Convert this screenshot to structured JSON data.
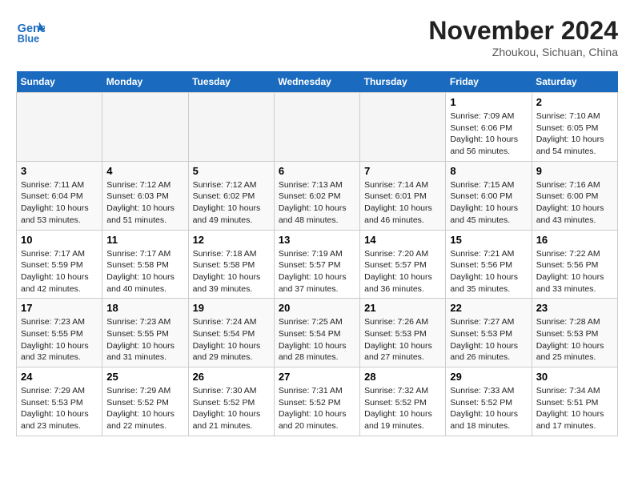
{
  "header": {
    "logo_line1": "General",
    "logo_line2": "Blue",
    "month": "November 2024",
    "location": "Zhoukou, Sichuan, China"
  },
  "weekdays": [
    "Sunday",
    "Monday",
    "Tuesday",
    "Wednesday",
    "Thursday",
    "Friday",
    "Saturday"
  ],
  "weeks": [
    [
      {
        "day": "",
        "info": ""
      },
      {
        "day": "",
        "info": ""
      },
      {
        "day": "",
        "info": ""
      },
      {
        "day": "",
        "info": ""
      },
      {
        "day": "",
        "info": ""
      },
      {
        "day": "1",
        "info": "Sunrise: 7:09 AM\nSunset: 6:06 PM\nDaylight: 10 hours\nand 56 minutes."
      },
      {
        "day": "2",
        "info": "Sunrise: 7:10 AM\nSunset: 6:05 PM\nDaylight: 10 hours\nand 54 minutes."
      }
    ],
    [
      {
        "day": "3",
        "info": "Sunrise: 7:11 AM\nSunset: 6:04 PM\nDaylight: 10 hours\nand 53 minutes."
      },
      {
        "day": "4",
        "info": "Sunrise: 7:12 AM\nSunset: 6:03 PM\nDaylight: 10 hours\nand 51 minutes."
      },
      {
        "day": "5",
        "info": "Sunrise: 7:12 AM\nSunset: 6:02 PM\nDaylight: 10 hours\nand 49 minutes."
      },
      {
        "day": "6",
        "info": "Sunrise: 7:13 AM\nSunset: 6:02 PM\nDaylight: 10 hours\nand 48 minutes."
      },
      {
        "day": "7",
        "info": "Sunrise: 7:14 AM\nSunset: 6:01 PM\nDaylight: 10 hours\nand 46 minutes."
      },
      {
        "day": "8",
        "info": "Sunrise: 7:15 AM\nSunset: 6:00 PM\nDaylight: 10 hours\nand 45 minutes."
      },
      {
        "day": "9",
        "info": "Sunrise: 7:16 AM\nSunset: 6:00 PM\nDaylight: 10 hours\nand 43 minutes."
      }
    ],
    [
      {
        "day": "10",
        "info": "Sunrise: 7:17 AM\nSunset: 5:59 PM\nDaylight: 10 hours\nand 42 minutes."
      },
      {
        "day": "11",
        "info": "Sunrise: 7:17 AM\nSunset: 5:58 PM\nDaylight: 10 hours\nand 40 minutes."
      },
      {
        "day": "12",
        "info": "Sunrise: 7:18 AM\nSunset: 5:58 PM\nDaylight: 10 hours\nand 39 minutes."
      },
      {
        "day": "13",
        "info": "Sunrise: 7:19 AM\nSunset: 5:57 PM\nDaylight: 10 hours\nand 37 minutes."
      },
      {
        "day": "14",
        "info": "Sunrise: 7:20 AM\nSunset: 5:57 PM\nDaylight: 10 hours\nand 36 minutes."
      },
      {
        "day": "15",
        "info": "Sunrise: 7:21 AM\nSunset: 5:56 PM\nDaylight: 10 hours\nand 35 minutes."
      },
      {
        "day": "16",
        "info": "Sunrise: 7:22 AM\nSunset: 5:56 PM\nDaylight: 10 hours\nand 33 minutes."
      }
    ],
    [
      {
        "day": "17",
        "info": "Sunrise: 7:23 AM\nSunset: 5:55 PM\nDaylight: 10 hours\nand 32 minutes."
      },
      {
        "day": "18",
        "info": "Sunrise: 7:23 AM\nSunset: 5:55 PM\nDaylight: 10 hours\nand 31 minutes."
      },
      {
        "day": "19",
        "info": "Sunrise: 7:24 AM\nSunset: 5:54 PM\nDaylight: 10 hours\nand 29 minutes."
      },
      {
        "day": "20",
        "info": "Sunrise: 7:25 AM\nSunset: 5:54 PM\nDaylight: 10 hours\nand 28 minutes."
      },
      {
        "day": "21",
        "info": "Sunrise: 7:26 AM\nSunset: 5:53 PM\nDaylight: 10 hours\nand 27 minutes."
      },
      {
        "day": "22",
        "info": "Sunrise: 7:27 AM\nSunset: 5:53 PM\nDaylight: 10 hours\nand 26 minutes."
      },
      {
        "day": "23",
        "info": "Sunrise: 7:28 AM\nSunset: 5:53 PM\nDaylight: 10 hours\nand 25 minutes."
      }
    ],
    [
      {
        "day": "24",
        "info": "Sunrise: 7:29 AM\nSunset: 5:53 PM\nDaylight: 10 hours\nand 23 minutes."
      },
      {
        "day": "25",
        "info": "Sunrise: 7:29 AM\nSunset: 5:52 PM\nDaylight: 10 hours\nand 22 minutes."
      },
      {
        "day": "26",
        "info": "Sunrise: 7:30 AM\nSunset: 5:52 PM\nDaylight: 10 hours\nand 21 minutes."
      },
      {
        "day": "27",
        "info": "Sunrise: 7:31 AM\nSunset: 5:52 PM\nDaylight: 10 hours\nand 20 minutes."
      },
      {
        "day": "28",
        "info": "Sunrise: 7:32 AM\nSunset: 5:52 PM\nDaylight: 10 hours\nand 19 minutes."
      },
      {
        "day": "29",
        "info": "Sunrise: 7:33 AM\nSunset: 5:52 PM\nDaylight: 10 hours\nand 18 minutes."
      },
      {
        "day": "30",
        "info": "Sunrise: 7:34 AM\nSunset: 5:51 PM\nDaylight: 10 hours\nand 17 minutes."
      }
    ]
  ]
}
